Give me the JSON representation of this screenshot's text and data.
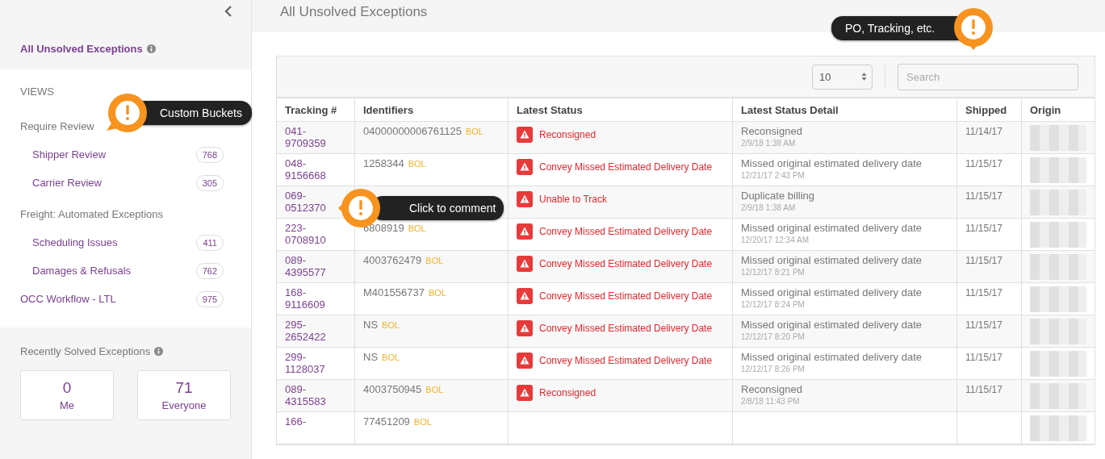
{
  "sidebar": {
    "title": "All Unsolved Exceptions",
    "views_heading": "VIEWS",
    "views": [
      {
        "kind": "group",
        "label": "Require Review",
        "children": [
          {
            "label": "Shipper Review",
            "count": "768"
          },
          {
            "label": "Carrier Review",
            "count": "305"
          }
        ]
      },
      {
        "kind": "group",
        "label": "Freight: Automated Exceptions",
        "children": [
          {
            "label": "Scheduling Issues",
            "count": "411"
          },
          {
            "label": "Damages & Refusals",
            "count": "762"
          }
        ]
      },
      {
        "kind": "item",
        "label": "OCC Workflow - LTL",
        "count": "975"
      }
    ],
    "solved": {
      "title": "Recently Solved Exceptions",
      "cards": [
        {
          "value": "0",
          "label": "Me"
        },
        {
          "value": "71",
          "label": "Everyone"
        }
      ]
    }
  },
  "page_title": "All Unsolved Exceptions",
  "toolbar": {
    "page_size": "10",
    "search": {
      "placeholder": "Search"
    }
  },
  "table": {
    "columns": [
      "Tracking #",
      "Identifiers",
      "Latest Status",
      "Latest Status Detail",
      "Shipped",
      "Origin"
    ],
    "rows": [
      {
        "tracking": "041-\n9709359",
        "identifier": "04000000006761125",
        "tag": "BOL",
        "status": "Reconsigned",
        "detail": "Reconsigned",
        "time": "2/9/18 1:38 AM",
        "shipped": "11/14/17"
      },
      {
        "tracking": "048-\n9156668",
        "identifier": "1258344",
        "tag": "BOL",
        "status": "Convey Missed Estimated Delivery Date",
        "detail": "Missed original estimated delivery date",
        "time": "12/21/17 2:43 PM",
        "shipped": "11/15/17"
      },
      {
        "tracking": "069-\n0512370",
        "status": "Unable to Track",
        "detail": "Duplicate billing",
        "time": "2/9/18 1:38 AM",
        "shipped": "11/15/17"
      },
      {
        "tracking": "223-\n0708910",
        "identifier": "6808919",
        "tag": "BOL",
        "status": "Convey Missed Estimated Delivery Date",
        "detail": "Missed original estimated delivery date",
        "time": "12/20/17 12:34 AM",
        "shipped": "11/15/17"
      },
      {
        "tracking": "089-\n4395577",
        "identifier": "4003762479",
        "tag": "BOL",
        "status": "Convey Missed Estimated Delivery Date",
        "detail": "Missed original estimated delivery date",
        "time": "12/12/17 8:21 PM",
        "shipped": "11/15/17"
      },
      {
        "tracking": "168-\n9116609",
        "identifier": "M401556737",
        "tag": "BOL",
        "status": "Convey Missed Estimated Delivery Date",
        "detail": "Missed original estimated delivery date",
        "time": "12/12/17 8:24 PM",
        "shipped": "11/15/17"
      },
      {
        "tracking": "295-\n2652422",
        "identifier": "NS",
        "tag": "BOL",
        "status": "Convey Missed Estimated Delivery Date",
        "detail": "Missed original estimated delivery date",
        "time": "12/12/17 8:20 PM",
        "shipped": "11/15/17"
      },
      {
        "tracking": "299-\n1128037",
        "identifier": "NS",
        "tag": "BOL",
        "status": "Convey Missed Estimated Delivery Date",
        "detail": "Missed original estimated delivery date",
        "time": "12/12/17 8:26 PM",
        "shipped": "11/15/17"
      },
      {
        "tracking": "089-\n4315583",
        "identifier": "4003750945",
        "tag": "BOL",
        "status": "Reconsigned",
        "detail": "Reconsigned",
        "time": "2/8/18 11:43 PM",
        "shipped": "11/15/17"
      },
      {
        "tracking": "166-",
        "identifier": "77451209",
        "tag": "BOL"
      }
    ]
  },
  "callouts": [
    {
      "text": "Custom Buckets"
    },
    {
      "text": "Click to comment"
    },
    {
      "text": "PO, Tracking, etc."
    }
  ]
}
